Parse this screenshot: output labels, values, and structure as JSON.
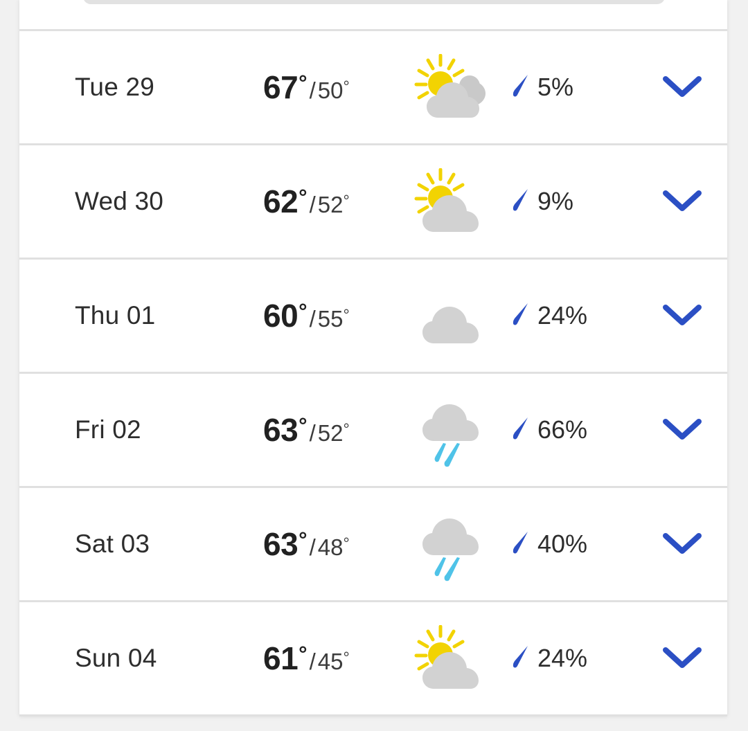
{
  "theme": {
    "page_background": "#f1f1f1",
    "card_background": "#ffffff",
    "divider": "#e0e0e0",
    "text_primary": "#212121",
    "text_secondary": "#3c3c3c",
    "accent_blue": "#2b4fc4",
    "precip_drop": "#2b4fc4",
    "rain_drop": "#4fc3e8",
    "cloud_gray": "#d2d2d2",
    "sun_yellow": "#f2d302"
  },
  "partial_top": {
    "chip_name": "cut-off-chip",
    "partial_row_name": "cut-off-forecast-row"
  },
  "forecast": {
    "rows": [
      {
        "day": "Tue 29",
        "high": "67",
        "deg": "°",
        "separator": "/",
        "low": "50",
        "icon": "partly-cloudy-scattered-icon",
        "precip": "5%",
        "precip_icon": "raindrop-icon",
        "expand_icon": "chevron-down-icon"
      },
      {
        "day": "Wed 30",
        "high": "62",
        "deg": "°",
        "separator": "/",
        "low": "52",
        "icon": "partly-cloudy-icon",
        "precip": "9%",
        "precip_icon": "raindrop-icon",
        "expand_icon": "chevron-down-icon"
      },
      {
        "day": "Thu 01",
        "high": "60",
        "deg": "°",
        "separator": "/",
        "low": "55",
        "icon": "cloudy-icon",
        "precip": "24%",
        "precip_icon": "raindrop-icon",
        "expand_icon": "chevron-down-icon"
      },
      {
        "day": "Fri 02",
        "high": "63",
        "deg": "°",
        "separator": "/",
        "low": "52",
        "icon": "rain-icon",
        "precip": "66%",
        "precip_icon": "raindrop-icon",
        "expand_icon": "chevron-down-icon"
      },
      {
        "day": "Sat 03",
        "high": "63",
        "deg": "°",
        "separator": "/",
        "low": "48",
        "icon": "rain-icon",
        "precip": "40%",
        "precip_icon": "raindrop-icon",
        "expand_icon": "chevron-down-icon"
      },
      {
        "day": "Sun 04",
        "high": "61",
        "deg": "°",
        "separator": "/",
        "low": "45",
        "icon": "partly-cloudy-icon",
        "precip": "24%",
        "precip_icon": "raindrop-icon",
        "expand_icon": "chevron-down-icon"
      }
    ]
  }
}
